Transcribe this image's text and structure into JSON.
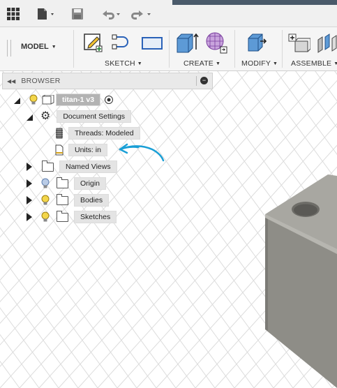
{
  "ribbon": {
    "workspace_label": "MODEL",
    "groups": {
      "sketch": "SKETCH",
      "create": "CREATE",
      "modify": "MODIFY",
      "assemble": "ASSEMBLE"
    }
  },
  "browser": {
    "title": "BROWSER",
    "tree": {
      "root": "titan-1 v3",
      "document_settings": "Document Settings",
      "threads": "Threads: Modeled",
      "units": "Units: in",
      "named_views": "Named Views",
      "origin": "Origin",
      "bodies": "Bodies",
      "sketches": "Sketches"
    }
  },
  "colors": {
    "annotation_arrow": "#1a9fd6",
    "bulb_on": "#f3d64a",
    "bulb_off": "#b9cbe6",
    "model_face_front": "#8e8d87",
    "model_face_top": "#a8a7a1"
  },
  "icons": [
    "grid-menu-icon",
    "file-icon",
    "save-icon",
    "undo-icon",
    "redo-icon",
    "create-sketch-icon",
    "spline-icon",
    "rectangle-icon",
    "extrude-icon",
    "form-icon",
    "press-pull-icon",
    "new-component-icon",
    "joint-icon",
    "gear-icon",
    "threads-icon",
    "units-document-icon",
    "folder-icon",
    "lightbulb-icon",
    "visibility-radio-icon"
  ]
}
